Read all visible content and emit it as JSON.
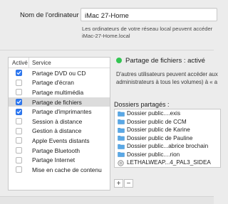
{
  "computer_name": {
    "label": "Nom de l'ordinateur :",
    "value": "iMac 27-Home",
    "hint_line1": "Les ordinateurs de votre réseau local peuvent accéder",
    "hint_line2": "iMac-27-Home.local"
  },
  "services": {
    "header_active": "Activé",
    "header_service": "Service",
    "items": [
      {
        "label": "Partage DVD ou CD",
        "checked": true,
        "selected": false
      },
      {
        "label": "Partage d'écran",
        "checked": false,
        "selected": false
      },
      {
        "label": "Partage multimédia",
        "checked": false,
        "selected": false
      },
      {
        "label": "Partage de fichiers",
        "checked": true,
        "selected": true
      },
      {
        "label": "Partage d'imprimantes",
        "checked": true,
        "selected": false
      },
      {
        "label": "Session à distance",
        "checked": false,
        "selected": false
      },
      {
        "label": "Gestion à distance",
        "checked": false,
        "selected": false
      },
      {
        "label": "Apple Events distants",
        "checked": false,
        "selected": false
      },
      {
        "label": "Partage Bluetooth",
        "checked": false,
        "selected": false
      },
      {
        "label": "Partage Internet",
        "checked": false,
        "selected": false
      },
      {
        "label": "Mise en cache de contenu",
        "checked": false,
        "selected": false
      }
    ]
  },
  "file_sharing": {
    "status": "Partage de fichiers : activé",
    "status_color": "#33c552",
    "desc_line1": "D'autres utilisateurs peuvent accéder aux",
    "desc_line2": "administrateurs à tous les volumes) à « a",
    "shared_folders_title": "Dossiers partagés :",
    "folders": [
      {
        "name": "Dossier public....exis",
        "icon": "folder-icon"
      },
      {
        "name": "Dossier public de CCM",
        "icon": "folder-icon"
      },
      {
        "name": "Dossier public de Karine",
        "icon": "folder-icon"
      },
      {
        "name": "Dossier public de Pauline",
        "icon": "folder-icon"
      },
      {
        "name": "Dossier public...abrice brochain",
        "icon": "folder-icon"
      },
      {
        "name": "Dossier public....rion",
        "icon": "folder-icon"
      },
      {
        "name": "LETHALWEAP...4_PAL3_SIDEA",
        "icon": "disc-icon"
      }
    ],
    "add_label": "+",
    "remove_label": "−"
  },
  "colors": {
    "accent": "#2f7bf6",
    "folder": "#5aa8e6"
  }
}
